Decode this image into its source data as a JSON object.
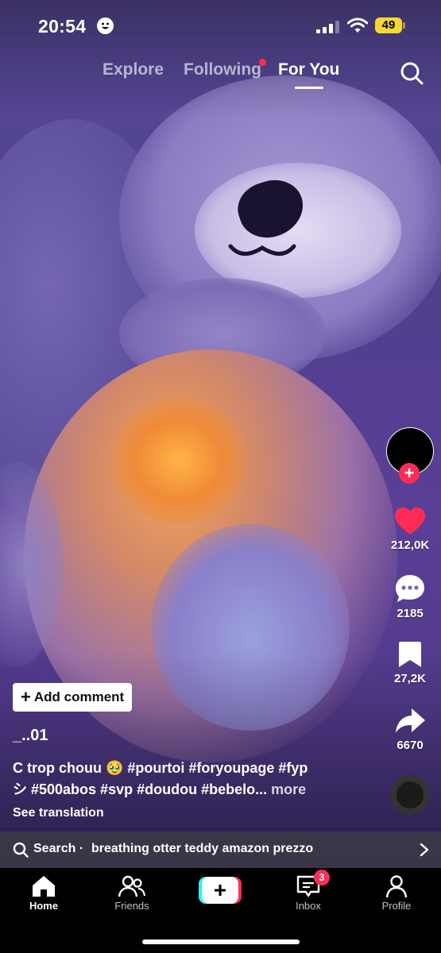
{
  "status_bar": {
    "time": "20:54",
    "battery": "49"
  },
  "top_nav": {
    "tabs": [
      {
        "label": "Explore",
        "active": false
      },
      {
        "label": "Following",
        "active": false,
        "has_dot": true
      },
      {
        "label": "For You",
        "active": true
      }
    ],
    "search_icon": "search-icon"
  },
  "video": {
    "description_icons": [
      "plush-otter"
    ],
    "accent_colors": {
      "purple": "#5a4a9a",
      "glow": "#f08a38"
    }
  },
  "right_rail": {
    "likes": "212,0K",
    "comments": "2185",
    "saves": "27,2K",
    "shares": "6670",
    "follow_icon": "plus-icon"
  },
  "post": {
    "add_comment": "Add comment",
    "username": "_..01",
    "caption_line1": "C trop chouu 🥹 #pourtoi #foryoupage #fyp",
    "caption_line2": "シ #500abos #svp #doudou #bebelo...",
    "more": "more",
    "see_translation": "See translation"
  },
  "search_suggestion": {
    "label": "Search ·",
    "query": "breathing otter teddy amazon prezzo"
  },
  "tab_bar": {
    "items": [
      {
        "label": "Home",
        "icon": "home-icon",
        "active": true
      },
      {
        "label": "Friends",
        "icon": "friends-icon",
        "active": false
      },
      {
        "label": "",
        "icon": "create-icon",
        "active": false
      },
      {
        "label": "Inbox",
        "icon": "inbox-icon",
        "active": false,
        "badge": "3"
      },
      {
        "label": "Profile",
        "icon": "profile-icon",
        "active": false
      }
    ]
  },
  "colors": {
    "brand_red": "#fe2c55",
    "brand_cyan": "#25f4ee",
    "battery_yellow": "#f7d731"
  }
}
